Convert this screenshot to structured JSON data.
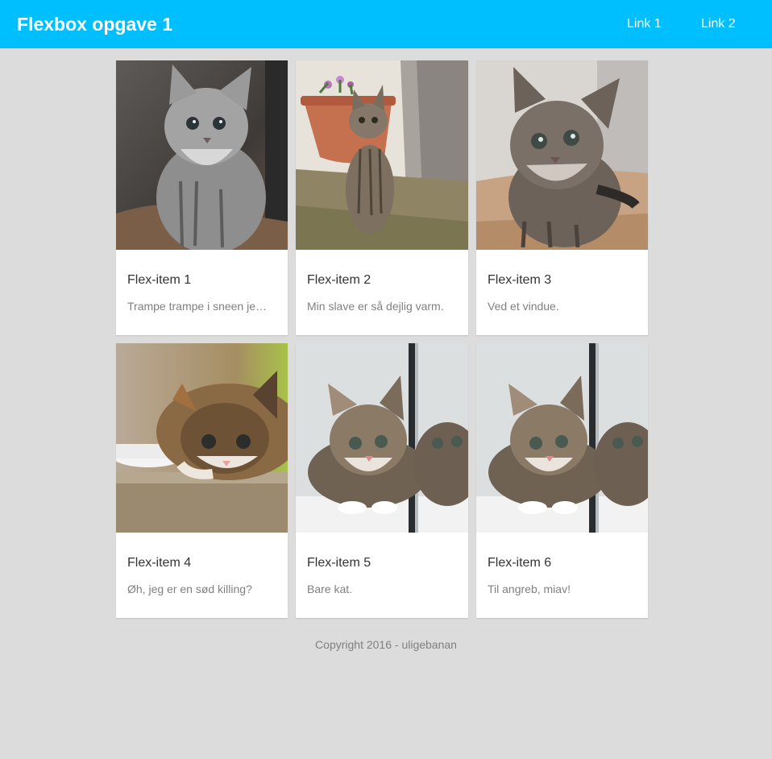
{
  "header": {
    "title": "Flexbox opgave 1",
    "links": [
      "Link 1",
      "Link 2"
    ]
  },
  "cards": [
    {
      "title": "Flex-item 1",
      "text": "Trampe trampe i sneen je…",
      "icon": "kitten-photo"
    },
    {
      "title": "Flex-item 2",
      "text": "Min slave er så dejlig varm.",
      "icon": "kitten-photo"
    },
    {
      "title": "Flex-item 3",
      "text": "Ved et vindue.",
      "icon": "kitten-photo"
    },
    {
      "title": "Flex-item 4",
      "text": "Øh, jeg er en sød killing?",
      "icon": "kitten-photo"
    },
    {
      "title": "Flex-item 5",
      "text": "Bare kat.",
      "icon": "kitten-photo"
    },
    {
      "title": "Flex-item 6",
      "text": "Til angreb, miav!",
      "icon": "kitten-photo"
    }
  ],
  "footer": {
    "text": "Copyright 2016 - uligebanan"
  },
  "colors": {
    "header": "#00bfff",
    "background": "#dcdcdc",
    "card": "#ffffff"
  }
}
